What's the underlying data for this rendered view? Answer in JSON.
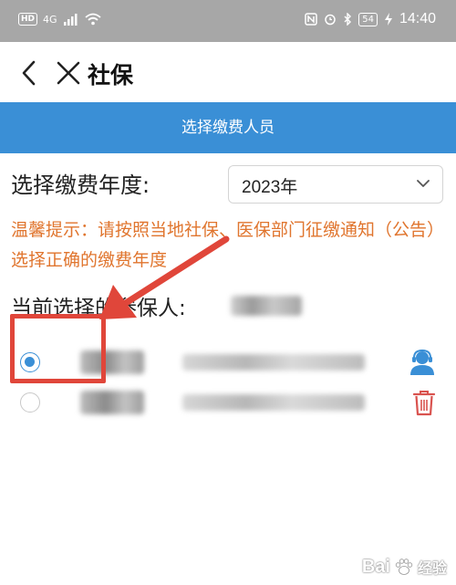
{
  "status_bar": {
    "hd": "HD",
    "network": "4G",
    "time": "14:40",
    "battery": "54"
  },
  "header": {
    "title": "社保"
  },
  "banner": {
    "text": "选择缴费人员"
  },
  "year": {
    "label": "选择缴费年度:",
    "selected": "2023年"
  },
  "tip": {
    "text": "温馨提示：请按照当地社保、医保部门征缴通知（公告）选择正确的缴费年度"
  },
  "current": {
    "label": "当前选择的参保人:"
  },
  "rows": [
    {
      "selected": true,
      "icon": "person-icon"
    },
    {
      "selected": false,
      "icon": "trash-icon"
    }
  ],
  "watermark": {
    "brand": "Bai",
    "suffix": "经验"
  },
  "colors": {
    "accent": "#3a8fd6",
    "tip": "#e0752e",
    "annotation": "#e0463a",
    "delete": "#d9534f"
  }
}
